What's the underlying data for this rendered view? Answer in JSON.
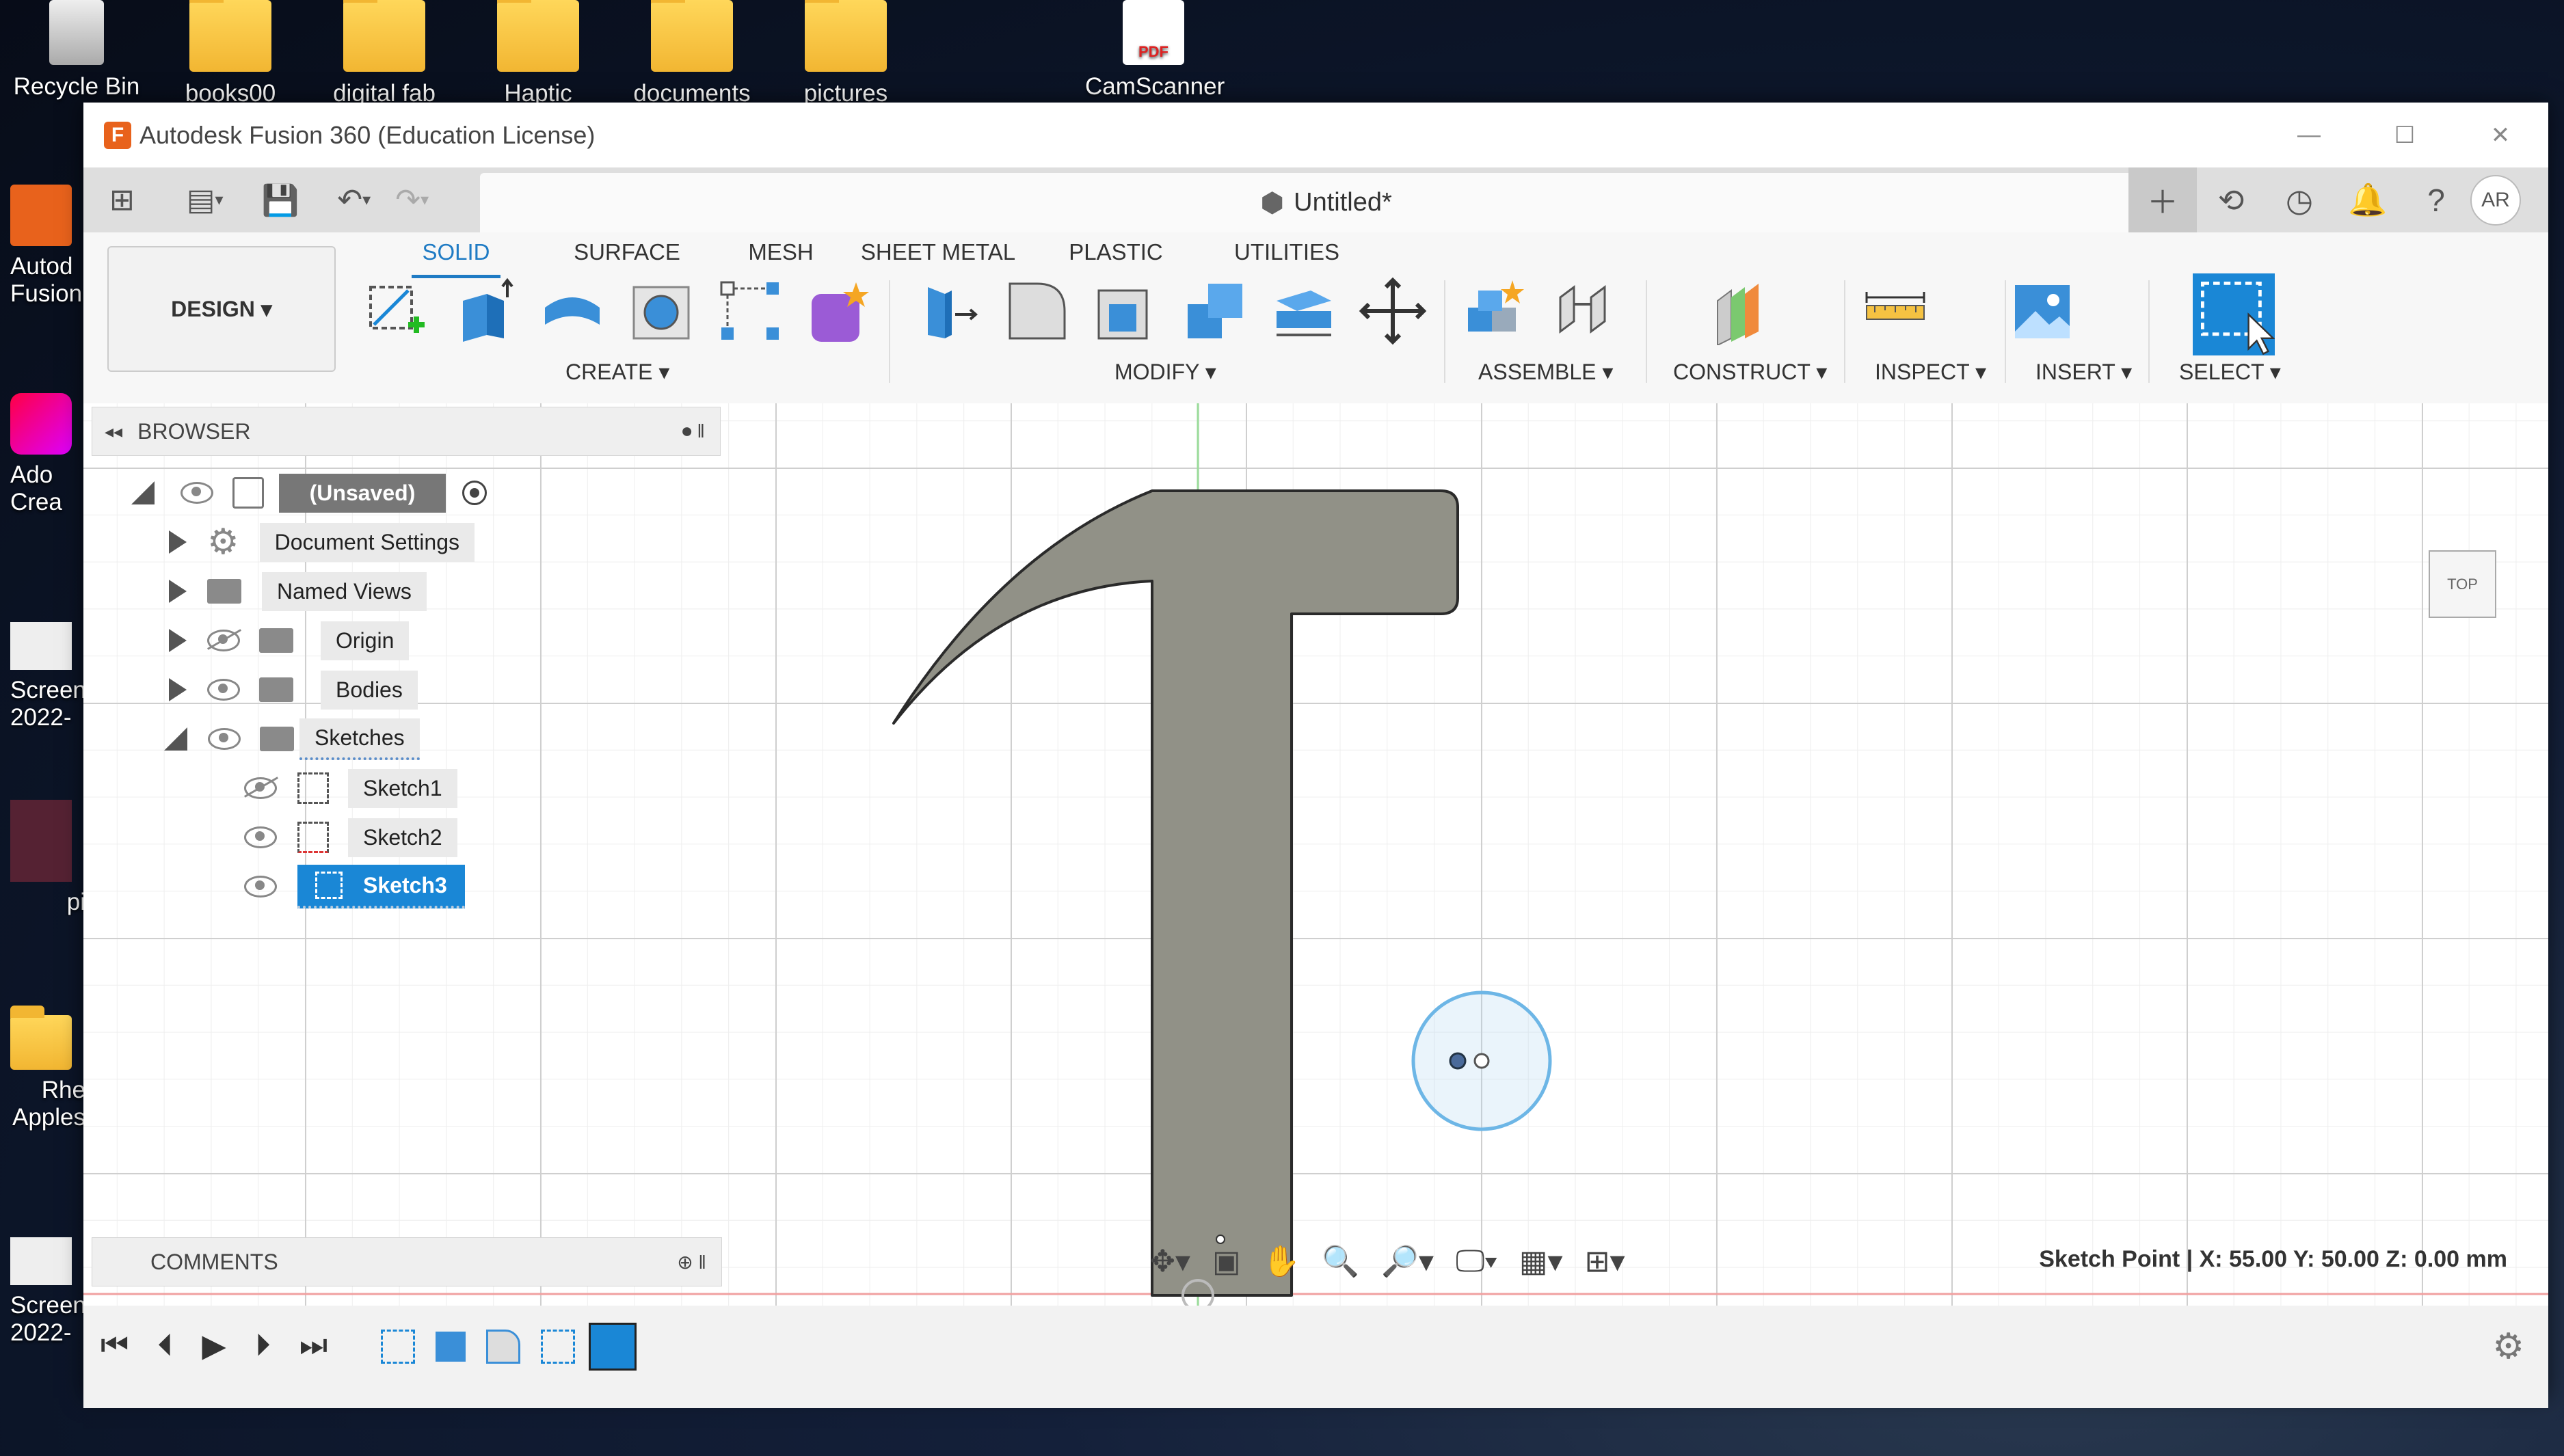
{
  "desktop": {
    "top_icons": [
      {
        "label": "Recycle Bin"
      },
      {
        "label": "books00"
      },
      {
        "label": "digital fab"
      },
      {
        "label": "Haptic"
      },
      {
        "label": "documents"
      },
      {
        "label": "pictures"
      },
      {
        "label": "CamScanner"
      }
    ],
    "left_icons": [
      {
        "label": "Autod Fusion"
      },
      {
        "label": "Ado Crea"
      },
      {
        "label": "Screen 2022-"
      },
      {
        "label": "pi"
      },
      {
        "label": "Rhe Apples"
      },
      {
        "label": "Screen 2022-"
      }
    ],
    "pdf_badge": "PDF"
  },
  "window": {
    "title": "Autodesk Fusion 360 (Education License)",
    "doc_title": "Untitled*",
    "avatar": "AR"
  },
  "ribbon": {
    "design_label": "DESIGN ▾",
    "tabs": [
      "SOLID",
      "SURFACE",
      "MESH",
      "SHEET METAL",
      "PLASTIC",
      "UTILITIES"
    ],
    "active_tab": "SOLID",
    "groups": [
      "CREATE ▾",
      "MODIFY ▾",
      "ASSEMBLE ▾",
      "CONSTRUCT ▾",
      "INSPECT ▾",
      "INSERT ▾",
      "SELECT ▾"
    ]
  },
  "browser": {
    "title": "BROWSER",
    "root": "(Unsaved)",
    "items": [
      "Document Settings",
      "Named Views",
      "Origin",
      "Bodies",
      "Sketches"
    ],
    "sketches": [
      "Sketch1",
      "Sketch2",
      "Sketch3"
    ]
  },
  "comments_label": "COMMENTS",
  "status_text": "Sketch Point | X: 55.00 Y: 50.00 Z: 0.00 mm",
  "viewcube_label": "TOP",
  "colors": {
    "accent": "#1a87d6",
    "hammer_fill": "#919187",
    "x_axis": "#e88",
    "y_axis": "#8d8"
  }
}
